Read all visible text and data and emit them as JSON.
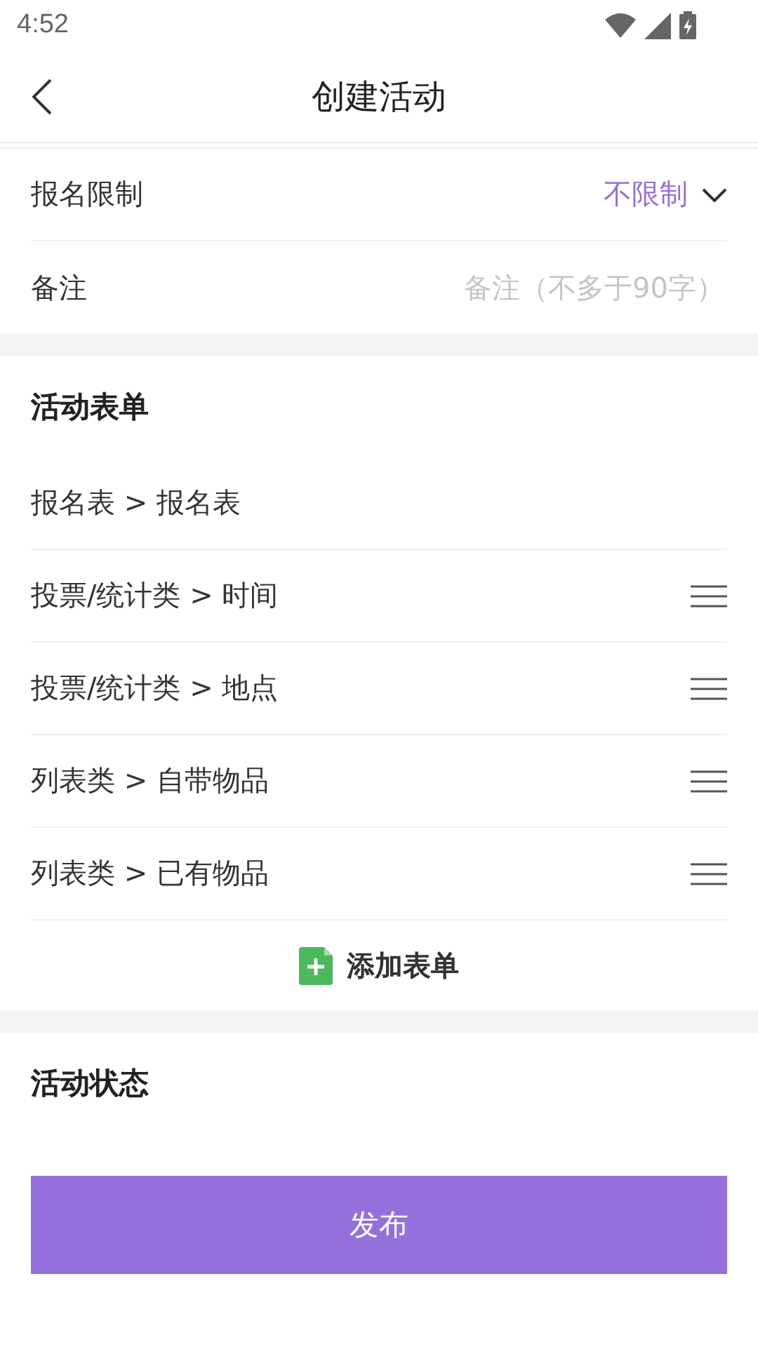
{
  "status_bar": {
    "time": "4:52"
  },
  "header": {
    "title": "创建活动"
  },
  "settings": [
    {
      "kind": "select",
      "label": "报名限制",
      "value": "不限制"
    },
    {
      "kind": "input",
      "label": "备注",
      "placeholder": "备注（不多于90字）"
    }
  ],
  "form_section": {
    "title": "活动表单",
    "items": [
      {
        "label": "报名表 > 报名表",
        "draggable": false
      },
      {
        "label": "投票/统计类 > 时间",
        "draggable": true
      },
      {
        "label": "投票/统计类 > 地点",
        "draggable": true
      },
      {
        "label": "列表类 > 自带物品",
        "draggable": true
      },
      {
        "label": "列表类 > 已有物品",
        "draggable": true
      }
    ],
    "add_button": "添加表单"
  },
  "status_section": {
    "title": "活动状态"
  },
  "publish_button": "发布"
}
